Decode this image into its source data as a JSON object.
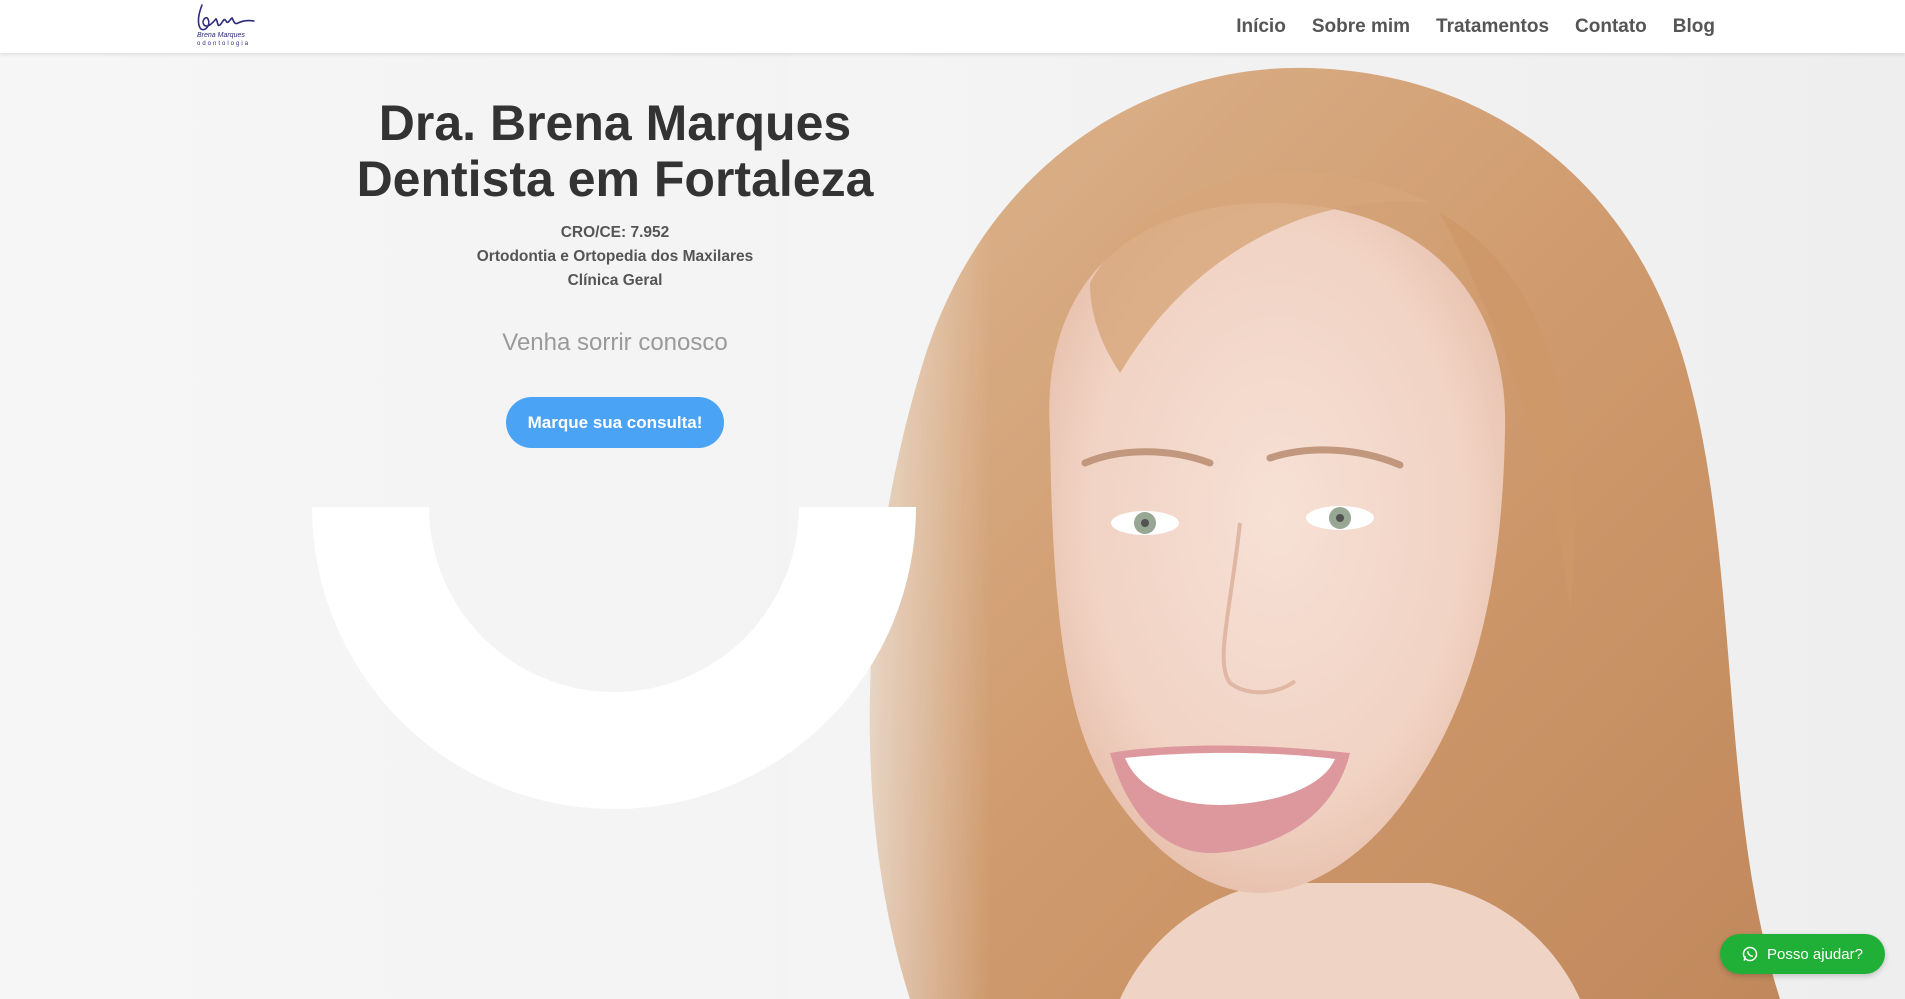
{
  "header": {
    "logo_name": "Brena Marques",
    "logo_sub": "odontologia",
    "nav": [
      "Início",
      "Sobre mim",
      "Tratamentos",
      "Contato",
      "Blog"
    ]
  },
  "hero": {
    "title_line1": "Dra. Brena Marques",
    "title_line2": "Dentista em Fortaleza",
    "cro": "CRO/CE: 7.952",
    "specialty": "Ortodontia e Ortopedia dos Maxilares",
    "specialty2": "Clínica Geral",
    "tagline": "Venha sorrir conosco",
    "cta_label": "Marque sua consulta!"
  },
  "whatsapp": {
    "label": "Posso ajudar?",
    "icon": "whatsapp-icon"
  },
  "colors": {
    "cta": "#4aa3f5",
    "whatsapp": "#20b038",
    "logo": "#2d2a7a"
  }
}
